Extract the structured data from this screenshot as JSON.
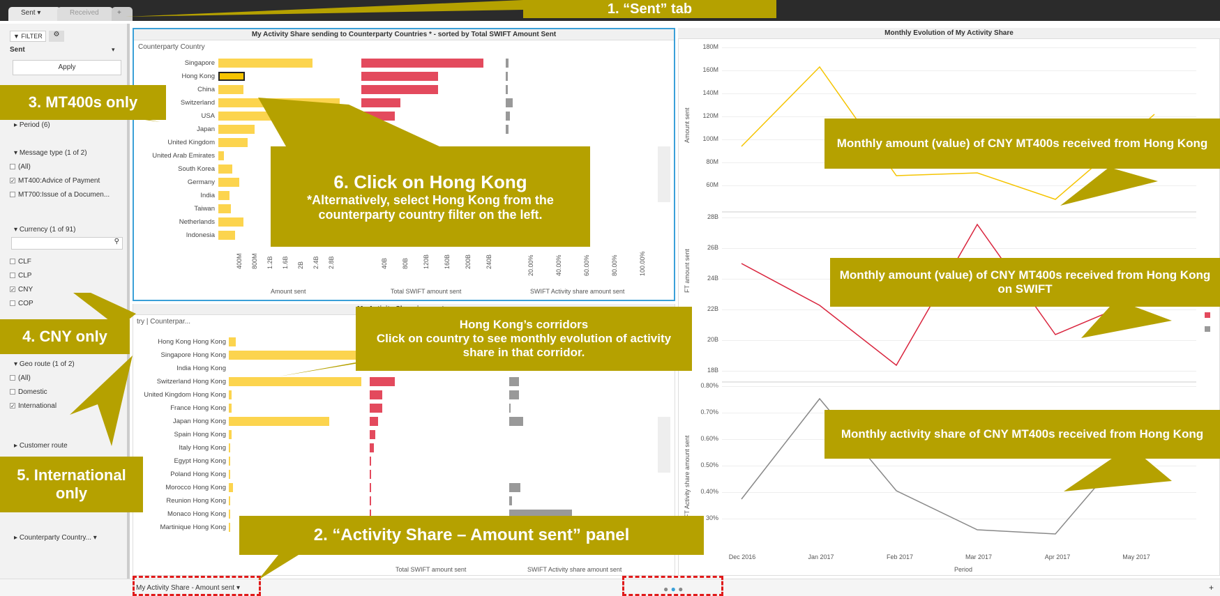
{
  "tabs": {
    "sent": "Sent",
    "received": "Received",
    "plus": "+"
  },
  "sidebar": {
    "filter_tab": "FILTER",
    "direction": "Sent",
    "apply": "Apply",
    "period": "Period (6)",
    "message_type": "Message type (1 of 2)",
    "mt_all": "(All)",
    "mt400": "MT400:Advice of Payment",
    "mt700": "MT700:Issue of a Documen...",
    "currency": "Currency (1 of 91)",
    "cur": [
      "CLF",
      "CLP",
      "CNY",
      "COP"
    ],
    "geo": "Geo route (1 of 2)",
    "geo_items": [
      "(All)",
      "Domestic",
      "International"
    ],
    "customer": "Customer route",
    "counterparty": "Counterparty Country..."
  },
  "top_panel": {
    "title": "My Activity Share sending to Counterparty Countries * - sorted by Total SWIFT Amount Sent",
    "col_header": "Counterparty Country",
    "countries": [
      "Singapore",
      "Hong Kong",
      "China",
      "Switzerland",
      "USA",
      "Japan",
      "United Kingdom",
      "United Arab Emirates",
      "South Korea",
      "Germany",
      "India",
      "Taiwan",
      "Netherlands",
      "Indonesia"
    ],
    "amount_ticks": [
      "400M",
      "800M",
      "1.2B",
      "1.6B",
      "2B",
      "2.4B",
      "2.8B"
    ],
    "swift_ticks": [
      "40B",
      "80B",
      "120B",
      "160B",
      "200B",
      "240B"
    ],
    "share_ticks": [
      "20.00%",
      "40.00%",
      "60.00%",
      "80.00%",
      "100.00%"
    ],
    "axis1": "Amount sent",
    "axis2": "Total SWIFT amount sent",
    "axis3": "SWIFT Activity share amount sent"
  },
  "bottom_panel": {
    "title": "My Activity Share in country",
    "col_header": "try | Counterpar...",
    "corridors": [
      "Hong Kong Hong Kong",
      "Singapore Hong Kong",
      "India Hong Kong",
      "Switzerland Hong Kong",
      "United Kingdom Hong Kong",
      "France Hong Kong",
      "Japan Hong Kong",
      "Spain Hong Kong",
      "Italy Hong Kong",
      "Egypt Hong Kong",
      "Poland Hong Kong",
      "Morocco Hong Kong",
      "Reunion Hong Kong",
      "Monaco Hong Kong",
      "Martinique Hong Kong"
    ],
    "axis2": "Total SWIFT amount sent",
    "axis3": "SWIFT Activity share amount sent"
  },
  "right_panel": {
    "title": "Monthly Evolution of My Activity Share",
    "t1": [
      "180M",
      "160M",
      "140M",
      "120M",
      "100M",
      "80M",
      "60M"
    ],
    "t2": [
      "28B",
      "26B",
      "24B",
      "22B",
      "20B",
      "18B"
    ],
    "t3": [
      "0.80%",
      "0.70%",
      "0.60%",
      "0.50%",
      "0.40%",
      "30%"
    ],
    "y1": "Amount sent",
    "y2": "FT amount sent",
    "y3": "SWIFT Activity share amount sent",
    "months": [
      "Dec 2016",
      "Jan 2017",
      "Feb 2017",
      "Mar 2017",
      "Apr 2017",
      "May 2017"
    ],
    "xlabel": "Period"
  },
  "footer": {
    "sheet": "My Activity Share - Amount sent",
    "plus": "+"
  },
  "callouts": {
    "c1": "1. “Sent” tab",
    "c2": "2. “Activity Share – Amount sent” panel",
    "c3": "3. MT400s only",
    "c4": "4. CNY only",
    "c5a": "5. International",
    "c5b": "only",
    "c6a": "6. Click on Hong Kong",
    "c6b": "*Alternatively, select Hong Kong from the counterparty country filter on the left.",
    "c7a": "Hong Kong’s corridors",
    "c7b": "Click on country to see monthly evolution of activity share in that corridor.",
    "c8": "Monthly amount (value) of CNY MT400s received from Hong Kong",
    "c9": "Monthly amount (value) of CNY MT400s received from Hong Kong on SWIFT",
    "c10": "Monthly activity share of CNY MT400s received from Hong Kong"
  },
  "colors": {
    "accent": "#b5a100",
    "yellow": "#fcd44e",
    "red": "#e34a5d",
    "grey": "#999999"
  }
}
